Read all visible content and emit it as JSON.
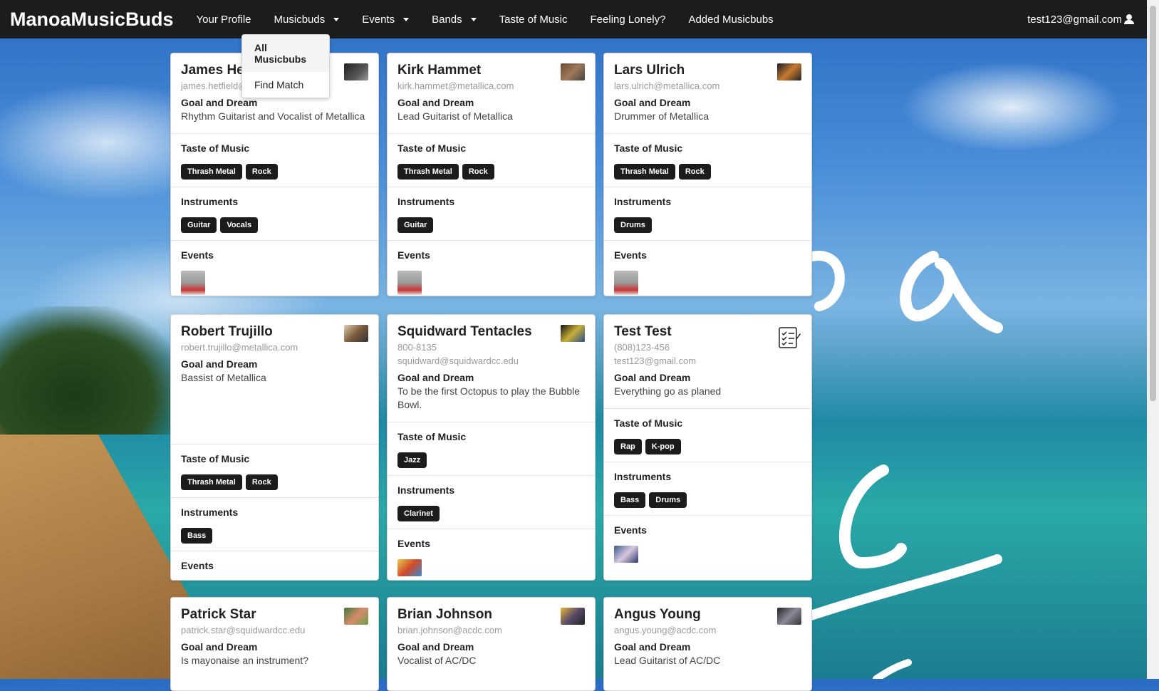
{
  "nav": {
    "brand": "ManoaMusicBuds",
    "items": [
      {
        "label": "Your Profile",
        "dropdown": false
      },
      {
        "label": "Musicbuds",
        "dropdown": true
      },
      {
        "label": "Events",
        "dropdown": true
      },
      {
        "label": "Bands",
        "dropdown": true
      },
      {
        "label": "Taste of Music",
        "dropdown": false
      },
      {
        "label": "Feeling Lonely?",
        "dropdown": false
      },
      {
        "label": "Added Musicbubs",
        "dropdown": false
      }
    ],
    "user": "test123@gmail.com",
    "user_icon": "user-icon"
  },
  "dropdown": {
    "items": [
      "All Musicbubs",
      "Find Match"
    ]
  },
  "labels": {
    "goal": "Goal and Dream",
    "taste": "Taste of Music",
    "instruments": "Instruments",
    "events": "Events"
  },
  "cards": [
    {
      "name": "James Hetfield",
      "lines": [
        "james.hetfield@metallica.com"
      ],
      "goal": "Rhythm Guitarist and Vocalist of Metallica",
      "taste": [
        "Thrash Metal",
        "Rock"
      ],
      "instruments": [
        "Guitar",
        "Vocals"
      ],
      "events": true
    },
    {
      "name": "Kirk Hammet",
      "lines": [
        "kirk.hammet@metallica.com"
      ],
      "goal": "Lead Guitarist of Metallica",
      "taste": [
        "Thrash Metal",
        "Rock"
      ],
      "instruments": [
        "Guitar"
      ],
      "events": true
    },
    {
      "name": "Lars Ulrich",
      "lines": [
        "lars.ulrich@metallica.com"
      ],
      "goal": "Drummer of Metallica",
      "taste": [
        "Thrash Metal",
        "Rock"
      ],
      "instruments": [
        "Drums"
      ],
      "events": true
    },
    {
      "name": "Robert Trujillo",
      "lines": [
        "robert.trujillo@metallica.com"
      ],
      "goal": "Bassist of Metallica",
      "taste": [
        "Thrash Metal",
        "Rock"
      ],
      "instruments": [
        "Bass"
      ],
      "events": false
    },
    {
      "name": "Squidward Tentacles",
      "lines": [
        "800-8135",
        "squidward@squidwardcc.edu"
      ],
      "goal": "To be the first Octopus to play the Bubble Bowl.",
      "taste": [
        "Jazz"
      ],
      "instruments": [
        "Clarinet"
      ],
      "events": true
    },
    {
      "name": "Test Test",
      "lines": [
        "(808)123-456",
        "test123@gmail.com"
      ],
      "goal": "Everything go as planed",
      "taste": [
        "Rap",
        "K-pop"
      ],
      "instruments": [
        "Bass",
        "Drums"
      ],
      "events": true
    },
    {
      "name": "Patrick Star",
      "lines": [
        "patrick.star@squidwardcc.edu"
      ],
      "goal": "Is mayonaise an instrument?"
    },
    {
      "name": "Brian Johnson",
      "lines": [
        "brian.johnson@acdc.com"
      ],
      "goal": "Vocalist of AC/DC"
    },
    {
      "name": "Angus Young",
      "lines": [
        "angus.young@acdc.com"
      ],
      "goal": "Lead Guitarist of AC/DC"
    }
  ]
}
